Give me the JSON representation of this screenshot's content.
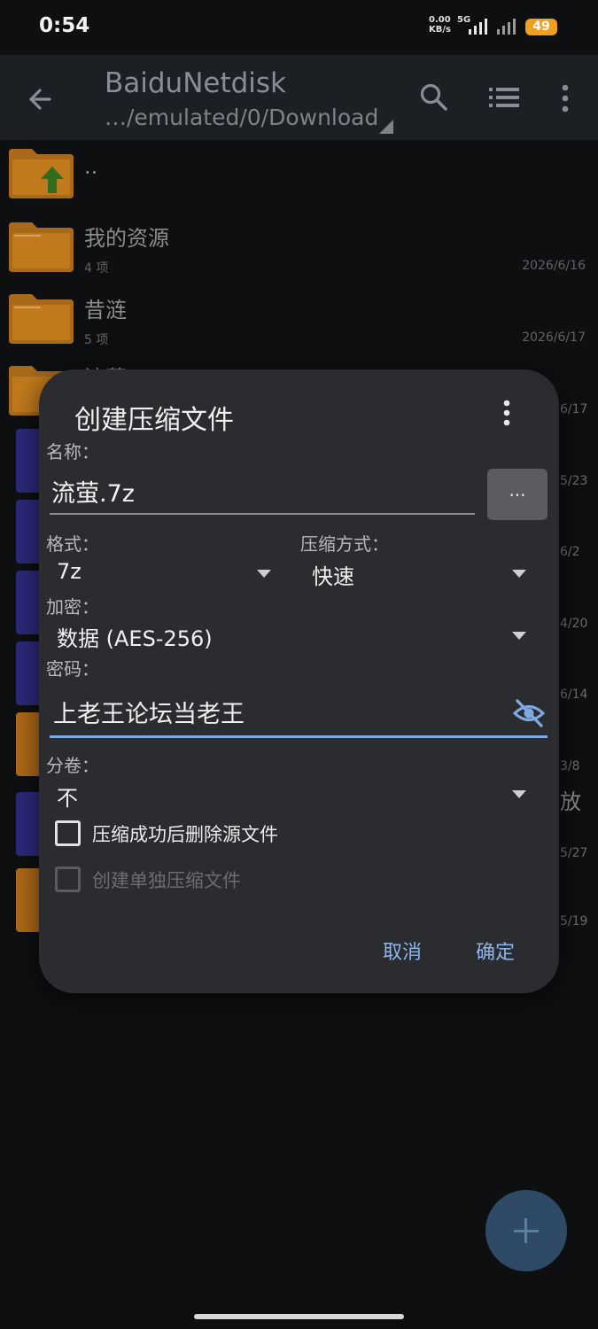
{
  "status_bar": {
    "time": "0:54",
    "net_speed_value": "0.00",
    "net_speed_unit": "KB/s",
    "network": "5G",
    "battery": "49"
  },
  "app_bar": {
    "title": "BaiduNetdisk",
    "path": "…/emulated/0/Download"
  },
  "files": [
    {
      "name": "..",
      "meta": "",
      "date": ""
    },
    {
      "name": "我的资源",
      "meta": "4 项",
      "date": "2026/6/16"
    },
    {
      "name": "昔涟",
      "meta": "5 项",
      "date": "2026/6/17"
    },
    {
      "name": "流萤",
      "meta": "",
      "date": ""
    }
  ],
  "obscured_dates": [
    "6/17",
    "5/23",
    "6/2",
    "4/20",
    "6/14",
    "3/8",
    "5/27",
    "5/19"
  ],
  "obscured_text": "放",
  "dialog": {
    "title": "创建压缩文件",
    "name_label": "名称：",
    "name_value": "流萤.7z",
    "browse_label": "...",
    "format_label": "格式：",
    "format_value": "7z",
    "method_label": "压缩方式：",
    "method_value": "快速",
    "encryption_label": "加密：",
    "encryption_value": "数据 (AES-256)",
    "password_label": "密码：",
    "password_value": "上老王论坛当老王",
    "volume_label": "分卷：",
    "volume_value": "不",
    "delete_source_label": "压缩成功后删除源文件",
    "delete_source_checked": false,
    "separate_archive_label": "创建单独压缩文件",
    "separate_archive_checked": false,
    "cancel_label": "取消",
    "confirm_label": "确定"
  },
  "colors": {
    "accent": "#8fb4ea",
    "dialog_bg": "#2a2c30",
    "folder": "#c07a1c",
    "fab": "#2f4a66"
  }
}
